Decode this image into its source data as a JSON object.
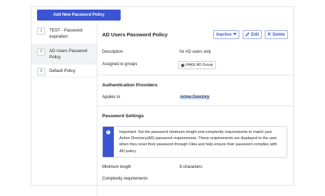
{
  "toolbar": {
    "add_label": "Add New Password Policy"
  },
  "sidebar": {
    "items": [
      {
        "num": "1",
        "label": "TEST - Password expiration"
      },
      {
        "num": "2",
        "label": "AD Users Password Policy"
      },
      {
        "num": "3",
        "label": "Default Policy"
      }
    ]
  },
  "policy": {
    "title": "AD Users Password Policy",
    "buttons": {
      "status": "Inactive",
      "edit": "Edit",
      "delete": "Delete"
    },
    "description_label": "Description",
    "description_value": "for AD users only",
    "assigned_label": "Assigned to groups",
    "group_name": "FAKE AD Group"
  },
  "auth_providers": {
    "heading": "Authentication Providers",
    "applies_label": "Applies to",
    "applies_value": "Active Directory"
  },
  "password_settings": {
    "heading": "Password Settings",
    "note_lines": [
      "Important: Set the password minimum length and complexity requirements to match your",
      "Active Directory(AD) password requirements. These requirements are displayed to the user",
      "when they reset their password through Okta and help ensure their password complies with",
      "AD policy."
    ],
    "min_length_label": "Minimum length",
    "min_length_value": "8 characters",
    "complexity_label": "Complexity requirements"
  },
  "colors": {
    "accent": "#3b54d3",
    "highlight": "#c9daf6"
  },
  "icons": {
    "status_caret": "caret-down-icon",
    "edit": "pencil-icon",
    "delete": "x-icon",
    "group": "group-icon",
    "info": "info-icon"
  }
}
